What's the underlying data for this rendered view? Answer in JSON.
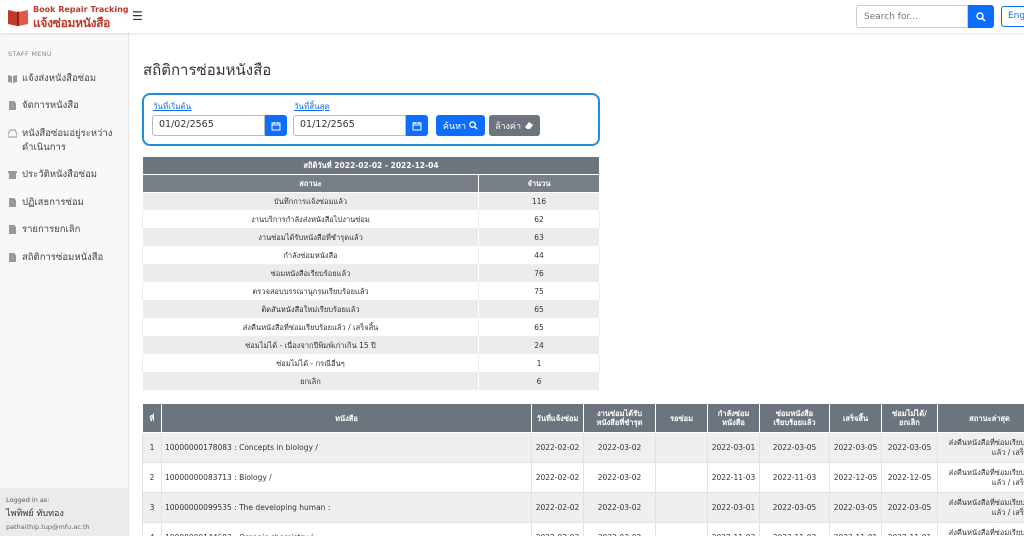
{
  "brand": {
    "top": "Book Repair Tracking",
    "main": "แจ้งซ่อมหนังสือ"
  },
  "topbar": {
    "menu_glyph": "☰",
    "search_placeholder": "Search for...",
    "lang_label": "English"
  },
  "sidebar": {
    "heading": "STAFF MENU",
    "items": [
      {
        "label": "แจ้งส่งหนังสือซ่อม",
        "icon": "book-icon"
      },
      {
        "label": "จัดการหนังสือ",
        "icon": "file-icon"
      },
      {
        "label": "หนังสือซ่อมอยู่ระหว่างดำเนินการ",
        "icon": "inbox-icon"
      },
      {
        "label": "ประวัติหนังสือซ่อม",
        "icon": "archive-icon"
      },
      {
        "label": "ปฏิเสธการซ่อม",
        "icon": "file-icon"
      },
      {
        "label": "รายการยกเลิก",
        "icon": "file-icon"
      },
      {
        "label": "สถิติการซ่อมหนังสือ",
        "icon": "file-icon"
      }
    ],
    "logged_as": "Logged in as:",
    "user_name": "ไพทิพย์ ทับทอง",
    "user_email": "pathaithip.tup@mfu.ac.th"
  },
  "page_title": "สถิติการซ่อมหนังสือ",
  "filter": {
    "start_label": "วันที่เริ่มต้น",
    "start_value": "01/02/2565",
    "end_label": "วันที่สิ้นสุด",
    "end_value": "01/12/2565",
    "search_label": "ค้นหา",
    "clear_label": "ล้างค่า"
  },
  "summary": {
    "title": "สถิติวันที่ 2022-02-02 - 2022-12-04",
    "col_status": "สถานะ",
    "col_count": "จำนวน",
    "rows": [
      {
        "status": "บันทึกการแจ้งซ่อมแล้ว",
        "count": "116"
      },
      {
        "status": "งานบริการกำลังส่งหนังสือไปงานซ่อม",
        "count": "62"
      },
      {
        "status": "งานซ่อมได้รับหนังสือที่ชำรุดแล้ว",
        "count": "63"
      },
      {
        "status": "กำลังซ่อมหนังสือ",
        "count": "44"
      },
      {
        "status": "ซ่อมหนังสือเรียบร้อยแล้ว",
        "count": "76"
      },
      {
        "status": "ตรวจสอบบรรณานุกรมเรียบร้อยแล้ว",
        "count": "75"
      },
      {
        "status": "ติดสันหนังสือใหม่เรียบร้อยแล้ว",
        "count": "65"
      },
      {
        "status": "ส่งคืนหนังสือที่ซ่อมเรียบร้อยแล้ว / เสร็จสิ้น",
        "count": "65"
      },
      {
        "status": "ซ่อมไม่ได้ - เนื่องจากปีพิมพ์เก่าเกิน 15 ปี",
        "count": "24"
      },
      {
        "status": "ซ่อมไม่ได้ - กรณีอื่นๆ",
        "count": "1"
      },
      {
        "status": "ยกเลิก",
        "count": "6"
      }
    ]
  },
  "details": {
    "headers": {
      "no": "ที่",
      "book": "หนังสือ",
      "reported": "วันที่แจ้งซ่อม",
      "received": "งานซ่อมได้รับหนังสือที่ชำรุด",
      "waiting": "รอซ่อม",
      "repairing": "กำลังซ่อมหนังสือ",
      "repaired": "ซ่อมหนังสือเรียบร้อยแล้ว",
      "done": "เสร็จสิ้น",
      "unrepairable": "ซ่อมไม่ได้/ยกเลิก",
      "latest": "สถานะล่าสุด"
    },
    "rows": [
      {
        "no": "1",
        "book": "10000000178083 : Concepts in biology /",
        "reported": "2022-02-02",
        "received": "2022-03-02",
        "waiting": "",
        "repairing": "2022-03-01",
        "repaired": "2022-03-05",
        "done": "2022-03-05",
        "unrepairable": "2022-03-05",
        "latest": "ส่งคืนหนังสือที่ซ่อมเรียบร้อยแล้ว / เสร็จสิ้น"
      },
      {
        "no": "2",
        "book": "10000000083713 : Biology /",
        "reported": "2022-02-02",
        "received": "2022-03-02",
        "waiting": "",
        "repairing": "2022-11-03",
        "repaired": "2022-11-03",
        "done": "2022-12-05",
        "unrepairable": "2022-12-05",
        "latest": "ส่งคืนหนังสือที่ซ่อมเรียบร้อยแล้ว / เสร็จสิ้น"
      },
      {
        "no": "3",
        "book": "10000000099535 : The developing human :",
        "reported": "2022-02-02",
        "received": "2022-03-02",
        "waiting": "",
        "repairing": "2022-03-01",
        "repaired": "2022-03-05",
        "done": "2022-03-05",
        "unrepairable": "2022-03-05",
        "latest": "ส่งคืนหนังสือที่ซ่อมเรียบร้อยแล้ว / เสร็จสิ้น"
      },
      {
        "no": "4",
        "book": "10000000144692 : Organic chemistry /",
        "reported": "2022-02-02",
        "received": "2022-03-02",
        "waiting": "",
        "repairing": "2022-11-03",
        "repaired": "2022-11-03",
        "done": "2022-11-01",
        "unrepairable": "2022-11-01",
        "latest": "ส่งคืนหนังสือที่ซ่อมเรียบร้อยแล้ว / เสร็จสิ้น"
      }
    ]
  }
}
